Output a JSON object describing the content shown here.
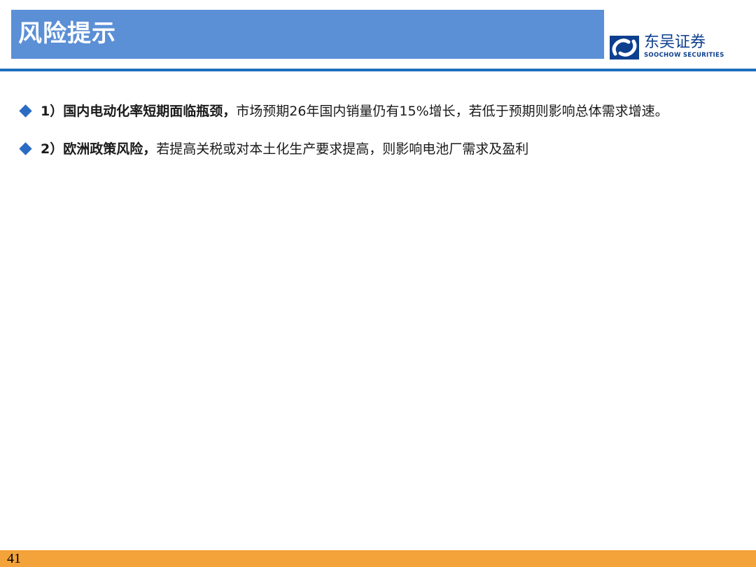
{
  "header": {
    "title": "风险提示"
  },
  "logo": {
    "name_cn": "东吴证券",
    "name_en": "SOOCHOW SECURITIES"
  },
  "bullets": [
    {
      "strong": "1）国内电动化率短期面临瓶颈，",
      "text": "市场预期26年国内销量仍有15%增长，若低于预期则影响总体需求增速。"
    },
    {
      "strong": "2）欧洲政策风险，",
      "text": "若提高关税或对本土化生产要求提高，则影响电池厂需求及盈利"
    }
  ],
  "footer": {
    "page_number": "41"
  },
  "colors": {
    "title_bar": "#5b8fd6",
    "rule": "#1f6fbf",
    "bullet": "#2a6cc4",
    "footer": "#f4a23a",
    "logo": "#0d3f8e"
  }
}
